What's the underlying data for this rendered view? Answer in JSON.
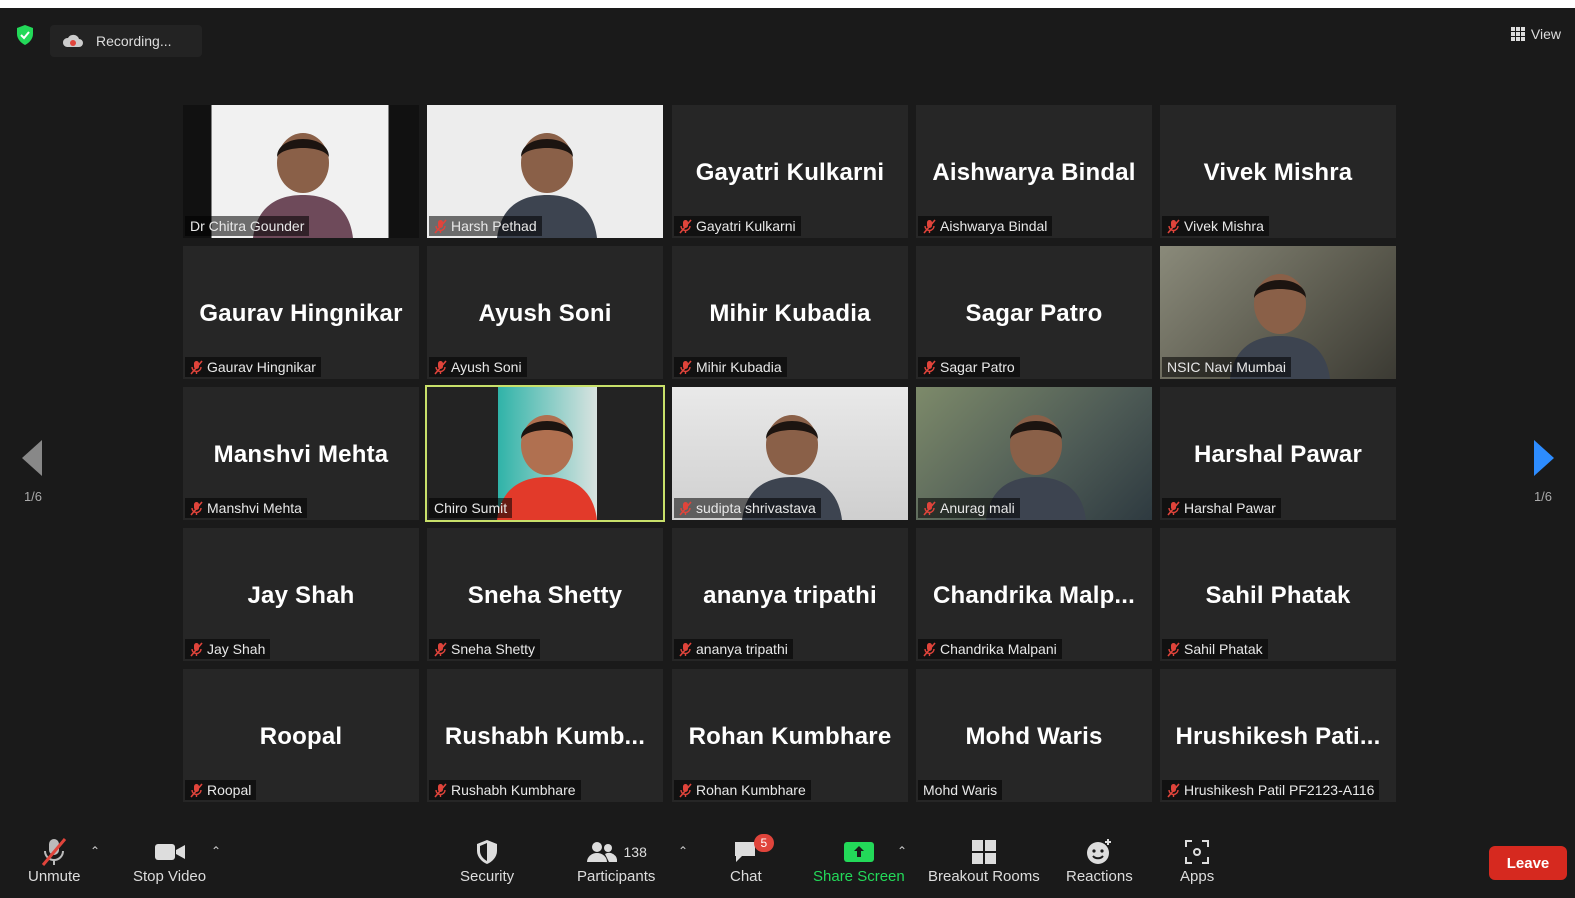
{
  "top": {
    "recording_label": "Recording...",
    "view_label": "View"
  },
  "pager": {
    "left": "1/6",
    "right": "1/6"
  },
  "tiles": [
    {
      "big": "",
      "label": "Dr Chitra Gounder",
      "muted": false,
      "video": true
    },
    {
      "big": "",
      "label": "Harsh Pethad",
      "muted": true,
      "video": true
    },
    {
      "big": "Gayatri Kulkarni",
      "label": "Gayatri Kulkarni",
      "muted": true,
      "video": false
    },
    {
      "big": "Aishwarya Bindal",
      "label": "Aishwarya Bindal",
      "muted": true,
      "video": false
    },
    {
      "big": "Vivek Mishra",
      "label": "Vivek Mishra",
      "muted": true,
      "video": false
    },
    {
      "big": "Gaurav Hingnikar",
      "label": "Gaurav Hingnikar",
      "muted": true,
      "video": false
    },
    {
      "big": "Ayush Soni",
      "label": "Ayush Soni",
      "muted": true,
      "video": false
    },
    {
      "big": "Mihir Kubadia",
      "label": "Mihir Kubadia",
      "muted": true,
      "video": false
    },
    {
      "big": "Sagar Patro",
      "label": "Sagar Patro",
      "muted": true,
      "video": false
    },
    {
      "big": "",
      "label": "NSIC Navi Mumbai",
      "muted": false,
      "video": true
    },
    {
      "big": "Manshvi Mehta",
      "label": "Manshvi Mehta",
      "muted": true,
      "video": false
    },
    {
      "big": "",
      "label": "Chiro Sumit",
      "muted": false,
      "video": true
    },
    {
      "big": "",
      "label": "sudipta shrivastava",
      "muted": true,
      "video": true
    },
    {
      "big": "",
      "label": "Anurag mali",
      "muted": true,
      "video": true
    },
    {
      "big": "Harshal Pawar",
      "label": "Harshal Pawar",
      "muted": true,
      "video": false
    },
    {
      "big": "Jay Shah",
      "label": "Jay Shah",
      "muted": true,
      "video": false
    },
    {
      "big": "Sneha Shetty",
      "label": "Sneha Shetty",
      "muted": true,
      "video": false
    },
    {
      "big": "ananya tripathi",
      "label": "ananya tripathi",
      "muted": true,
      "video": false
    },
    {
      "big": "Chandrika  Malp...",
      "label": "Chandrika Malpani",
      "muted": true,
      "video": false
    },
    {
      "big": "Sahil Phatak",
      "label": "Sahil Phatak",
      "muted": true,
      "video": false
    },
    {
      "big": "Roopal",
      "label": "Roopal",
      "muted": true,
      "video": false
    },
    {
      "big": "Rushabh  Kumb...",
      "label": "Rushabh Kumbhare",
      "muted": true,
      "video": false
    },
    {
      "big": "Rohan Kumbhare",
      "label": "Rohan Kumbhare",
      "muted": true,
      "video": false
    },
    {
      "big": "Mohd Waris",
      "label": "Mohd Waris",
      "muted": false,
      "video": false
    },
    {
      "big": "Hrushikesh  Pati...",
      "label": "Hrushikesh Patil PF2123-A116",
      "muted": true,
      "video": false
    }
  ],
  "toolbar": {
    "unmute": "Unmute",
    "stop_video": "Stop Video",
    "security": "Security",
    "participants": "Participants",
    "participants_count": "138",
    "chat": "Chat",
    "chat_badge": "5",
    "share_screen": "Share Screen",
    "breakout_rooms": "Breakout Rooms",
    "reactions": "Reactions",
    "apps": "Apps",
    "leave": "Leave"
  },
  "colors": {
    "accent_green": "#23d959",
    "speaking_border": "#c8e06a",
    "leave_red": "#d6291f",
    "mute_red": "#e0443b",
    "nav_blue": "#2d8cff"
  }
}
